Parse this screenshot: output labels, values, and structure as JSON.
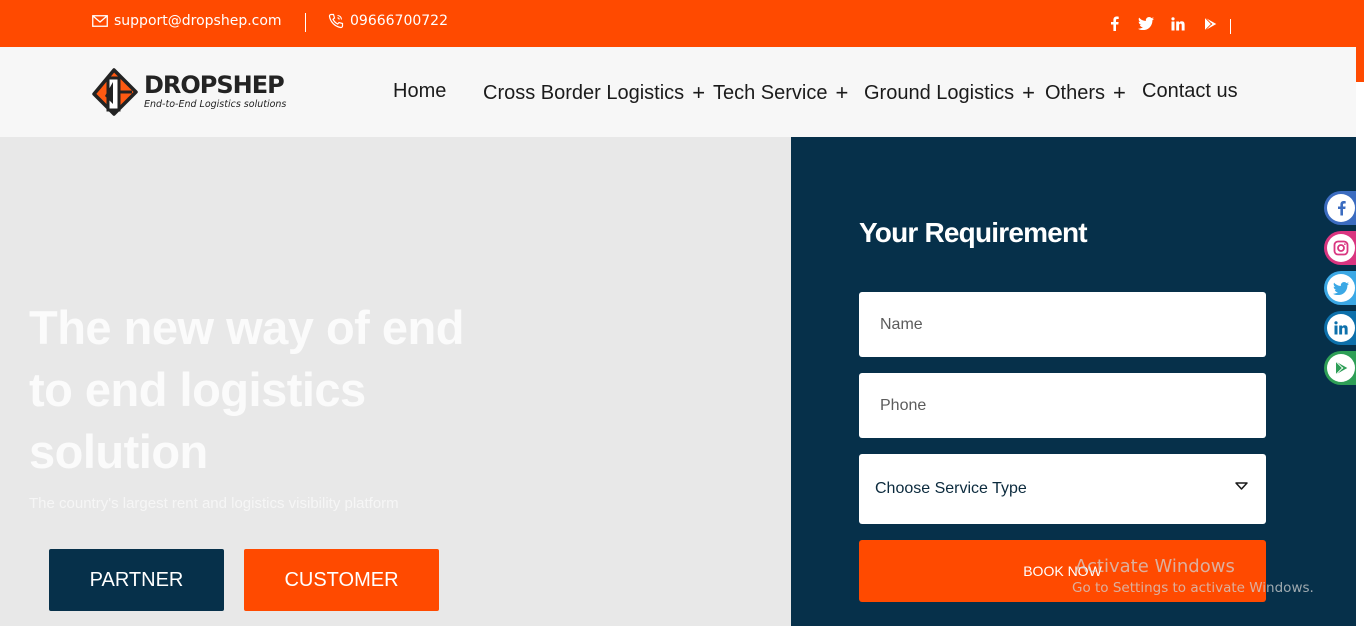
{
  "topbar": {
    "email": "support@dropshep.com",
    "phone": "09666700722",
    "social_icons": [
      "facebook-icon",
      "twitter-icon",
      "linkedin-icon",
      "google-play-icon"
    ]
  },
  "brand": {
    "name": "DROPSHEP",
    "tagline": "End-to-End Logistics solutions"
  },
  "nav": {
    "home": "Home",
    "cross_border": "Cross Border Logistics",
    "tech_service": "Tech Service",
    "ground_logistics": "Ground Logistics",
    "others": "Others",
    "contact": "Contact us",
    "plus": "+"
  },
  "hero": {
    "title": "The new way of end to end logistics solution",
    "subtitle": "The country's largest rent and logistics visibility platform",
    "partner_label": "PARTNER",
    "customer_label": "CUSTOMER"
  },
  "form": {
    "title": "Your Requirement",
    "name_placeholder": "Name",
    "phone_placeholder": "Phone",
    "service_selected": "Choose Service Type",
    "book_label": "BOOK NOW"
  },
  "floating_social": [
    "facebook-icon",
    "instagram-icon",
    "twitter-icon",
    "linkedin-icon",
    "google-play-icon"
  ],
  "watermark": {
    "title": "Activate Windows",
    "subtitle": "Go to Settings to activate Windows."
  },
  "colors": {
    "accent": "#ff4a00",
    "navy": "#06304a"
  }
}
